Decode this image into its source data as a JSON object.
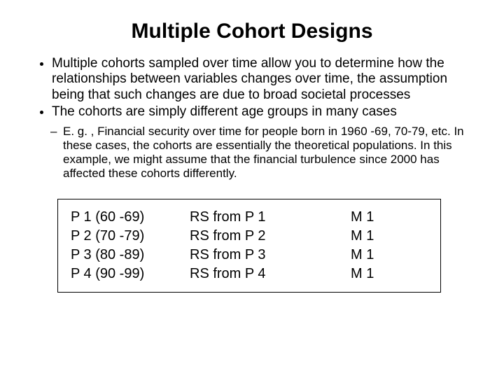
{
  "title": "Multiple Cohort Designs",
  "bullets": {
    "level1": [
      "Multiple cohorts sampled over time allow you to determine how the relationships between variables changes over time, the assumption being that such changes are due to broad societal processes",
      "The cohorts are simply different age groups in many cases"
    ],
    "level2": [
      "E. g. , Financial security over time for people born in 1960 -69, 70-79, etc. In these cases, the cohorts are essentially the theoretical populations. In this example, we might assume that the financial turbulence since 2000 has affected these cohorts differently."
    ]
  },
  "table": {
    "rows": [
      {
        "c1": "P 1 (60 -69)",
        "c2": "RS from P 1",
        "c3": "M 1"
      },
      {
        "c1": "P 2 (70 -79)",
        "c2": "RS from P 2",
        "c3": "M 1"
      },
      {
        "c1": "P 3 (80 -89)",
        "c2": "RS from P 3",
        "c3": "M 1"
      },
      {
        "c1": "P 4 (90 -99)",
        "c2": "RS from P 4",
        "c3": "M 1"
      }
    ]
  }
}
